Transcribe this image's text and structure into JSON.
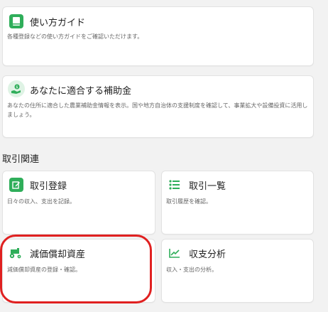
{
  "cards": {
    "guide": {
      "title": "使い方ガイド",
      "desc": "各種登録などの使い方ガイドをご確認いただけます。",
      "icon": "book-icon"
    },
    "subsidy": {
      "title": "あなたに適合する補助金",
      "desc": "あなたの住所に適合した農業補助金情報を表示。国や地方自治体の支援制度を確認して、事業拡大や設備投資に活用しましょう。",
      "icon": "hand-coin-icon"
    }
  },
  "section": {
    "heading": "取引関連"
  },
  "tiles": {
    "register": {
      "title": "取引登録",
      "desc": "日々の収入、支出を記録。",
      "icon": "edit-icon"
    },
    "list": {
      "title": "取引一覧",
      "desc": "取引履歴を確認。",
      "icon": "list-icon"
    },
    "depreciation": {
      "title": "減価償却資産",
      "desc": "減価償却資産の登録・確認。",
      "icon": "tractor-icon"
    },
    "analysis": {
      "title": "収支分析",
      "desc": "収入・支出の分析。",
      "icon": "line-chart-icon"
    }
  },
  "colors": {
    "accent": "#2fae5a",
    "highlight": "#e02020"
  }
}
